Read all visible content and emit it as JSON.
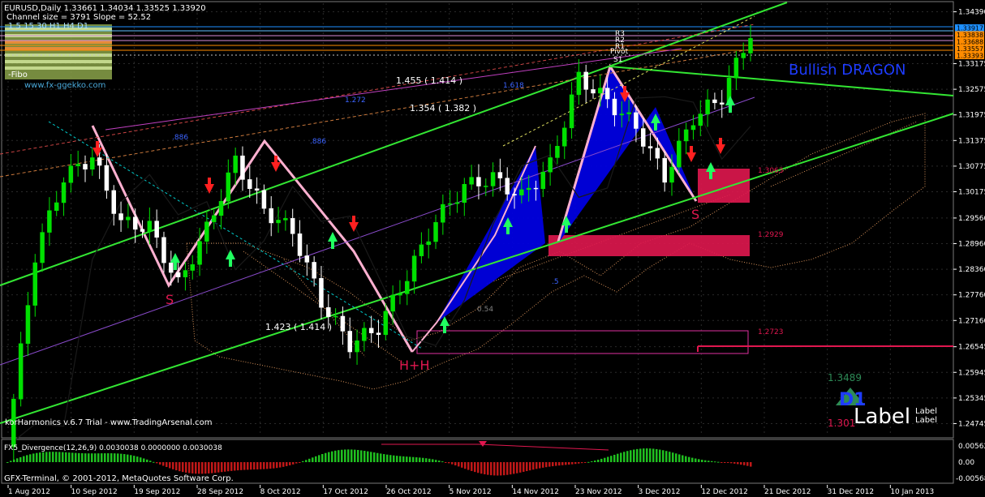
{
  "header": {
    "symbol_line": "EURUSD,Daily  1.33661 1.34034 1.33525 1.33920",
    "channel_line": "Channel size = 3791 Slope = 52.52",
    "tf_line": "1  5  15  30  H1  H4  D1",
    "fibo_label": "-Fibo",
    "website": "www.fx-ggekko.com"
  },
  "annotations": {
    "bullish_dragon": "Bullish DRAGON",
    "ratio_1": "1.455 ( 1.414 )",
    "ratio_2": "1.354 ( 1.382 )",
    "ratio_3": "1.423 ( 1.414 )",
    "fib_1272": "1.272",
    "fib_1618": "1.618",
    "fib_886_a": ".886",
    "fib_886_b": ".886",
    "fib_054": "0.54",
    "fib_5": ".5",
    "label_s1": "S",
    "label_s2": "S",
    "label_h": "H+H",
    "pivot_r3": "R3",
    "pivot_r2": "R2",
    "pivot_r1": "R1",
    "pivot": "Pivot",
    "pivot_s1": "S1",
    "copyright_tag": "korHarmonics v.6.7 Trial - www.TradingArsenal.com",
    "d1_value": "1.3489",
    "d1_label": "D1",
    "d1_low": "1.301",
    "label_big": "Label",
    "label_small_1": "Label",
    "label_small_2": "Label",
    "zone_1": "1.3063",
    "zone_2": "1.2929",
    "zone_3": "1.2723"
  },
  "indicator": {
    "title": "FX5_Divergence(12,26,9) 0.0030038 0.0000000 0.0030038",
    "ticks": [
      "0.00562",
      "0.00",
      "-0.00568"
    ]
  },
  "footer": {
    "terminal": "GFX-Terminal, © 2001-2012, MetaQuotes Software Corp."
  },
  "colors": {
    "background": "#000000",
    "bull_candle": "#00e000",
    "bear_candle": "#ffffff",
    "channel": "#33e633",
    "pattern_fill": "#0000e6",
    "zone": "#e0174f",
    "current_price_box": "#1e90ff",
    "pivot_box": "#ff8c00"
  },
  "chart_data": {
    "type": "line",
    "symbol": "EURUSD",
    "timeframe": "Daily",
    "x": [
      "1 Aug 2012",
      "10 Sep 2012",
      "19 Sep 2012",
      "28 Sep 2012",
      "8 Oct 2012",
      "17 Oct 2012",
      "26 Oct 2012",
      "5 Nov 2012",
      "14 Nov 2012",
      "23 Nov 2012",
      "3 Dec 2012",
      "12 Dec 2012",
      "21 Dec 2012",
      "31 Dec 2012",
      "10 Jan 2013"
    ],
    "y_ticks": [
      "1.34390",
      "1.33175",
      "1.32575",
      "1.31975",
      "1.31375",
      "1.30775",
      "1.30175",
      "1.29560",
      "1.28960",
      "1.28360",
      "1.27760",
      "1.27160",
      "1.26545",
      "1.25945",
      "1.25345",
      "1.24745"
    ],
    "price_boxes": [
      {
        "value": "1.33917",
        "role": "current"
      },
      {
        "value": "1.33838",
        "role": "pivot"
      },
      {
        "value": "1.33688",
        "role": "pivot"
      },
      {
        "value": "1.33557",
        "role": "pivot"
      },
      {
        "value": "1.33393",
        "role": "pivot"
      }
    ],
    "ylim": [
      1.2445,
      1.3459
    ],
    "series": [
      {
        "name": "EURUSD Close",
        "values": [
          1.242,
          1.2868,
          1.305,
          1.31,
          1.2945,
          1.2935,
          1.28,
          1.293,
          1.309,
          1.2975,
          1.2925,
          1.276,
          1.266,
          1.27,
          1.282,
          1.295,
          1.303,
          1.305,
          1.3005,
          1.308,
          1.3285,
          1.323,
          1.317,
          1.3052,
          1.319,
          1.324,
          1.339
        ]
      }
    ]
  }
}
